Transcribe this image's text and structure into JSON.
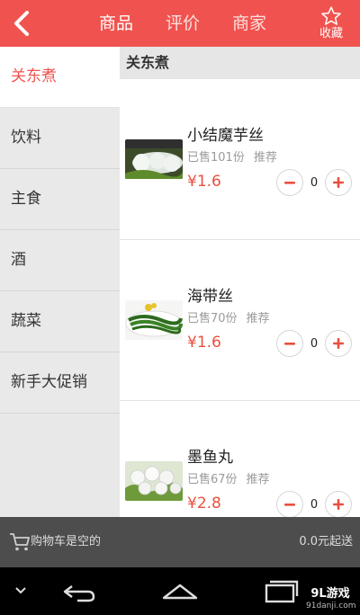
{
  "header": {
    "tabs": [
      {
        "label": "商品",
        "active": true
      },
      {
        "label": "评价",
        "active": false
      },
      {
        "label": "商家",
        "active": false
      }
    ],
    "favorite_label": "收藏",
    "icons": {
      "back": "back-chevron-icon",
      "favorite": "star-icon"
    },
    "color": "#f0534f"
  },
  "sidebar": {
    "categories": [
      {
        "label": "关东煮",
        "active": true
      },
      {
        "label": "饮料",
        "active": false
      },
      {
        "label": "主食",
        "active": false
      },
      {
        "label": "酒",
        "active": false
      },
      {
        "label": "蔬菜",
        "active": false
      },
      {
        "label": "新手大促销",
        "active": false
      }
    ]
  },
  "main": {
    "section_title": "关东煮",
    "products": [
      {
        "name": "小结魔芋丝",
        "sold": "已售101份",
        "tag": "推荐",
        "price": "¥1.6",
        "quantity": "0"
      },
      {
        "name": "海带丝",
        "sold": "已售70份",
        "tag": "推荐",
        "price": "¥1.6",
        "quantity": "0"
      },
      {
        "name": "墨鱼丸",
        "sold": "已售67份",
        "tag": "推荐",
        "price": "¥2.8",
        "quantity": "0"
      }
    ]
  },
  "cart": {
    "status": "购物车是空的",
    "minimum": "0.0元起送",
    "icon": "cart-icon"
  },
  "system_nav": {
    "icons": [
      "collapse-icon",
      "back-icon",
      "home-icon",
      "recents-icon"
    ]
  },
  "watermark": {
    "main": "9L游戏",
    "sub": "91danji.com"
  },
  "colors": {
    "accent": "#f0534f",
    "price": "#e8503e",
    "cart_bar": "#4d4d4d"
  }
}
